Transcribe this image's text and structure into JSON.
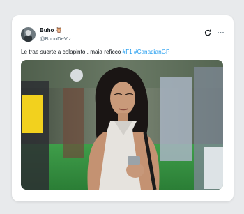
{
  "post": {
    "display_name": "Buho",
    "badge_icon": "owl-icon",
    "handle": "@BuhoDeVlz",
    "text": "Le trae suerte a colapinto , maia reficco",
    "hashtags": [
      "#F1",
      "#CanadianGP"
    ]
  },
  "actions": {
    "refresh_icon": "refresh-icon",
    "more_icon": "more-options-icon"
  },
  "colors": {
    "hashtag": "#1d9bf0",
    "name": "#0f1419",
    "handle": "#536471",
    "background": "#e8eaec"
  }
}
